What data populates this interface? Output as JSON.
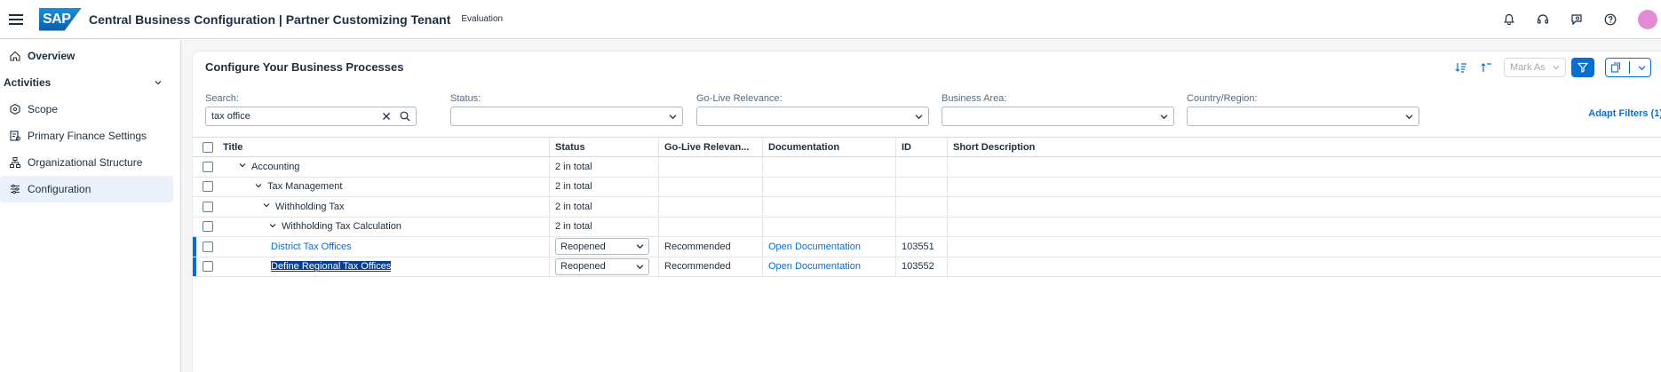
{
  "shell": {
    "logo": "SAP",
    "title": "Central Business Configuration | Partner Customizing Tenant",
    "environment": "Evaluation",
    "icons": [
      "bell-icon",
      "headset-icon",
      "feedback-icon",
      "help-icon",
      "user-avatar"
    ]
  },
  "sidenav": {
    "overview": "Overview",
    "activities": "Activities",
    "items": [
      {
        "label": "Scope",
        "icon": "scope-icon"
      },
      {
        "label": "Primary Finance Settings",
        "icon": "finance-settings-icon"
      },
      {
        "label": "Organizational Structure",
        "icon": "org-structure-icon"
      },
      {
        "label": "Configuration",
        "icon": "configuration-icon"
      }
    ]
  },
  "panel": {
    "title": "Configure Your Business Processes",
    "mark_as": "Mark As",
    "adapt_filters": "Adapt Filters (1)"
  },
  "filters": {
    "search_label": "Search:",
    "search_value": "tax office",
    "status_label": "Status:",
    "golive_label": "Go-Live Relevance:",
    "area_label": "Business Area:",
    "country_label": "Country/Region:"
  },
  "table": {
    "columns": {
      "title": "Title",
      "status": "Status",
      "golive": "Go-Live Relevan...",
      "doc": "Documentation",
      "id": "ID",
      "desc": "Short Description"
    },
    "rows": [
      {
        "level": 0,
        "title": "Accounting",
        "status": "2 in total"
      },
      {
        "level": 1,
        "title": "Tax Management",
        "status": "2 in total"
      },
      {
        "level": 2,
        "title": "Withholding Tax",
        "status": "2 in total"
      },
      {
        "level": 3,
        "title": "Withholding Tax Calculation",
        "status": "2 in total"
      },
      {
        "title": "District Tax Offices",
        "status": "Reopened",
        "golive": "Recommended",
        "doc": "Open Documentation",
        "id": "103551"
      },
      {
        "title": "Define Regional Tax Offices",
        "status": "Reopened",
        "golive": "Recommended",
        "doc": "Open Documentation",
        "id": "103552"
      }
    ]
  },
  "colors": {
    "accent": "#0a6ed1",
    "selection": "#0a3e8c"
  }
}
